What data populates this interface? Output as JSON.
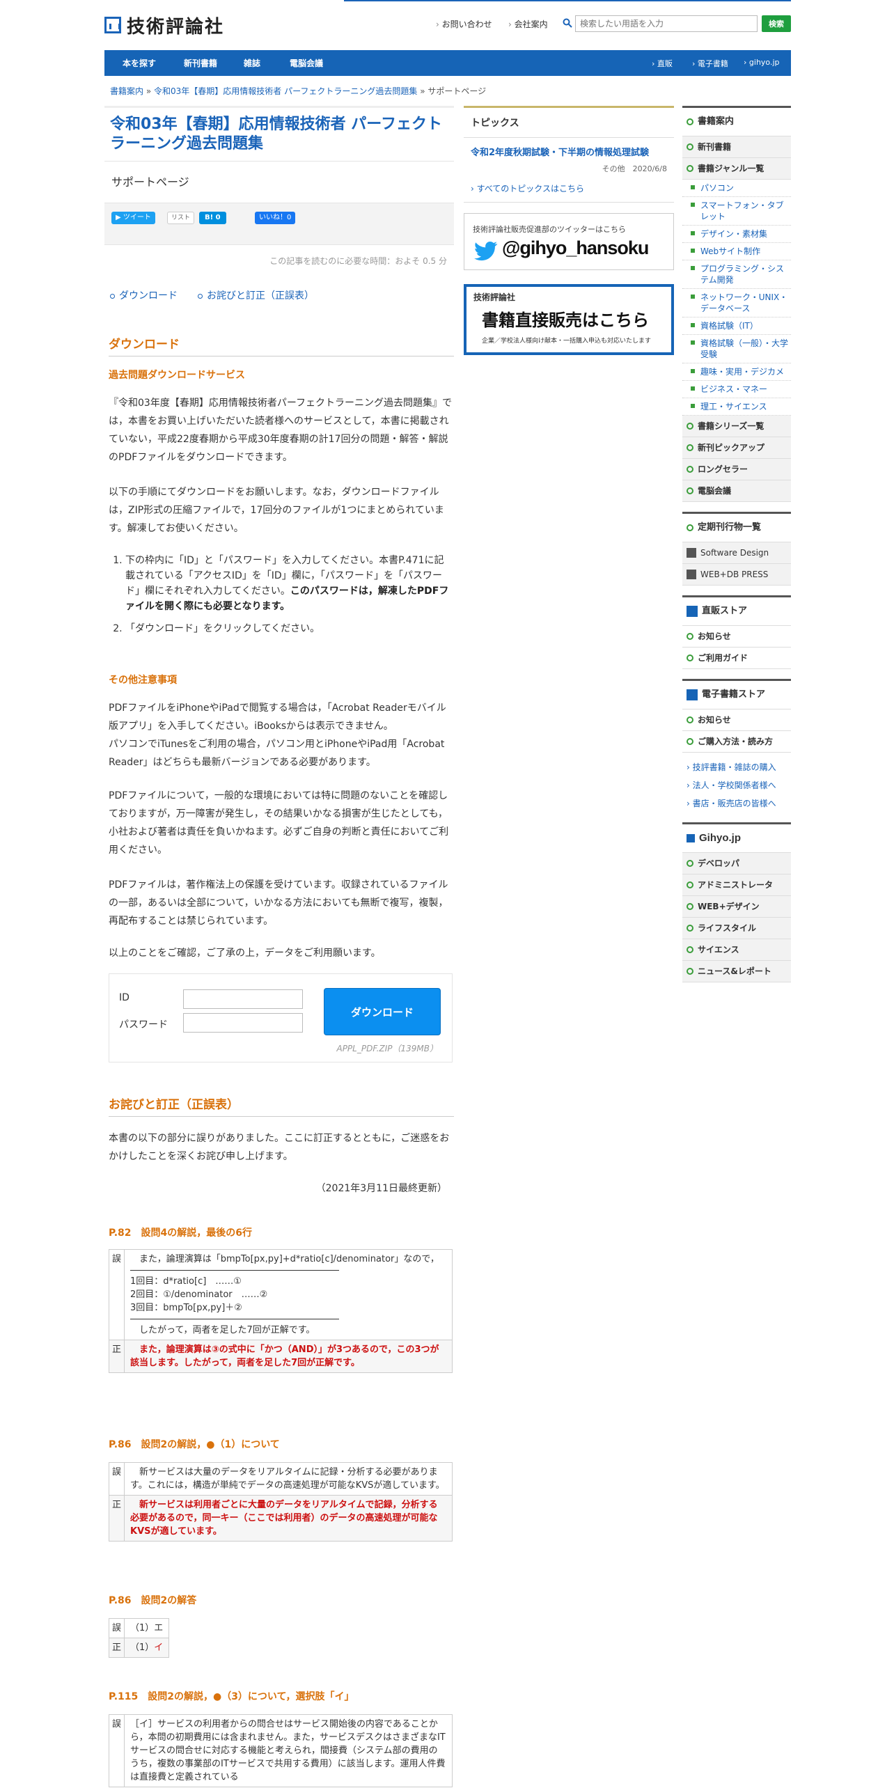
{
  "header": {
    "logo_text": "技術評論社",
    "links": [
      "お問い合わせ",
      "会社案内"
    ],
    "search_placeholder": "検索したい用語を入力",
    "search_button": "検索"
  },
  "nav": {
    "items": [
      "本を探す",
      "新刊書籍",
      "雑誌",
      "電脳会議"
    ],
    "right_items": [
      "直販",
      "電子書籍",
      "gihyo.jp"
    ]
  },
  "breadcrumb": {
    "items": [
      "書籍案内",
      "令和03年【春期】応用情報技術者 パーフェクトラーニング過去問題集"
    ],
    "current": "サポートページ",
    "separator": "»"
  },
  "article": {
    "title": "令和03年【春期】応用情報技術者 パーフェクトラーニング過去問題集",
    "subtitle": "サポートページ",
    "social": {
      "tweet": "ツイート",
      "list": "リスト",
      "hatena": "B! 0",
      "like": "いいね！0"
    },
    "read_time": "この記事を読むのに必要な時間：およそ 0.5 分",
    "toc": [
      "ダウンロード",
      "お詫びと訂正（正誤表）"
    ],
    "download": {
      "heading": "ダウンロード",
      "sub_heading": "過去問題ダウンロードサービス",
      "para1": "『令和03年度【春期】応用情報技術者パーフェクトラーニング過去問題集』では，本書をお買い上げいただいた読者様へのサービスとして，本書に掲載されていない，平成22度春期から平成30年度春期の計17回分の問題・解答・解説のPDFファイルをダウンロードできます。",
      "para2": "以下の手順にてダウンロードをお願いします。なお，ダウンロードファイルは，ZIP形式の圧縮ファイルで，17回分のファイルが1つにまとめられています。解凍してお使いください。",
      "step1": "下の枠内に「ID」と「パスワード」を入力してください。本書P.471に記載されている「アクセスID」を「ID」欄に，「パスワード」を「パスワード」欄にそれぞれ入力してください。",
      "step1_bold": "このパスワードは，解凍したPDFファイルを開く際にも必要となります。",
      "step2": "「ダウンロード」をクリックしてください。",
      "notes_heading": "その他注意事項",
      "note1": "PDFファイルをiPhoneやiPadで閲覧する場合は，「Acrobat Readerモバイル版アプリ」を入手してください。iBooksからは表示できません。",
      "note1b": "パソコンでiTunesをご利用の場合，パソコン用とiPhoneやiPad用「Acrobat Reader」はどちらも最新バージョンである必要があります。",
      "note2": "PDFファイルについて，一般的な環境においては特に問題のないことを確認しておりますが，万一障害が発生し，その結果いかなる損害が生じたとしても，小社および著者は責任を負いかねます。必ずご自身の判断と責任においてご利用ください。",
      "note3": "PDFファイルは，著作権法上の保護を受けています。収録されているファイルの一部，あるいは全部について，いかなる方法においても無断で複写，複製，再配布することは禁じられています。",
      "note4": "以上のことをご確認，ご了承の上，データをご利用願います。",
      "id_label": "ID",
      "password_label": "パスワード",
      "button": "ダウンロード",
      "file": "APPL_PDF.ZIP（139MB）"
    },
    "errata": {
      "heading": "お詫びと訂正（正誤表）",
      "intro": "本書の以下の部分に誤りがありました。ここに訂正するとともに，ご迷惑をおかけしたことを深くお詫び申し上げます。",
      "updated": "（2021年3月11日最終更新）",
      "wrong_label": "誤",
      "right_label": "正",
      "e1": {
        "heading": "P.82　設問4の解説，最後の6行",
        "w1": "　また，論理演算は「bmpTo[px,py]+d*ratio[c]/denominator」なので，",
        "w2": "1回目：d*ratio[c]　……①",
        "w3": "2回目：①/denominator　……②",
        "w4": "3回目：bmpTo[px,py]＋②",
        "w5": "　したがって，両者を足した7回が正解です。",
        "r": "　また，論理演算は③の式中に「かつ（AND）」が3つあるので，この3つが該当します。したがって，両者を足した7回が正解です。"
      },
      "e2": {
        "heading": "P.86　設問2の解説，●（1）について",
        "w": "　新サービスは大量のデータをリアルタイムに記録・分析する必要があります。これには，構造が単純でデータの高速処理が可能なKVSが適しています。",
        "r": "　新サービスは利用者ごとに大量のデータをリアルタイムで記録，分析する必要があるので，同一キー（ここでは利用者）のデータの高速処理が可能なKVSが適しています。"
      },
      "e3": {
        "heading": "P.86　設問2の解答",
        "w": "（1）エ",
        "r_prefix": "（1）",
        "r_value": "イ"
      },
      "e4": {
        "heading": "P.115　設問2の解説，●（3）について，選択肢「イ」",
        "w": "［イ］サービスの利用者からの問合せはサービス開始後の内容であることから，本問の初期費用には含まれません。また，サービスデスクはさまざまなITサービスの問合せに対応する機能と考えられ，間接費（システム部の費用のうち，複数の事業部のITサービスで共用する費用）に該当します。運用人件費は直接費と定義されている"
      }
    }
  },
  "topics": {
    "title": "トピックス",
    "item_title": "令和2年度秋期試験・下半期の情報処理試験",
    "item_meta": "その他　2020/6/8",
    "all_link": "すべてのトピックスはこちら",
    "twitter_caption": "技術評論社販売促進部のツイッターはこちら",
    "twitter_handle": "@gihyo_hansoku",
    "banner_logo": "技術評論社",
    "banner_main": "書籍直接販売はこちら",
    "banner_sub": "企業／学校法人様向け献本・一括購入申込も対応いたします"
  },
  "sidebar": {
    "books_head": "書籍案内",
    "new_books": "新刊書籍",
    "genre": "書籍ジャンル一覧",
    "genres": [
      "パソコン",
      "スマートフォン・タブレット",
      "デザイン・素材集",
      "Webサイト制作",
      "プログラミング・システム開発",
      "ネットワーク・UNIX・データベース",
      "資格試験（IT）",
      "資格試験（一般）・大学受験",
      "趣味・実用・デジカメ",
      "ビジネス・マネー",
      "理工・サイエンス"
    ],
    "series": "書籍シリーズ一覧",
    "pickup": "新刊ピックアップ",
    "longseller": "ロングセラー",
    "denno": "電脳会議",
    "periodicals_head": "定期刊行物一覧",
    "periodicals": [
      "Software Design",
      "WEB+DB PRESS"
    ],
    "store_head": "直販ストア",
    "store_items": [
      "お知らせ",
      "ご利用ガイド"
    ],
    "ebook_head": "電子書籍ストア",
    "ebook_items": [
      "お知らせ",
      "ご購入方法・読み方"
    ],
    "links": [
      "技評書籍・雑誌の購入",
      "法人・学校関係者様へ",
      "書店・販売店の皆様へ"
    ],
    "gihyo_logo": "Gihyo.jp",
    "gihyo_items": [
      "デベロッパ",
      "アドミニストレータ",
      "WEB+デザイン",
      "ライフスタイル",
      "サイエンス",
      "ニュース&レポート"
    ]
  }
}
